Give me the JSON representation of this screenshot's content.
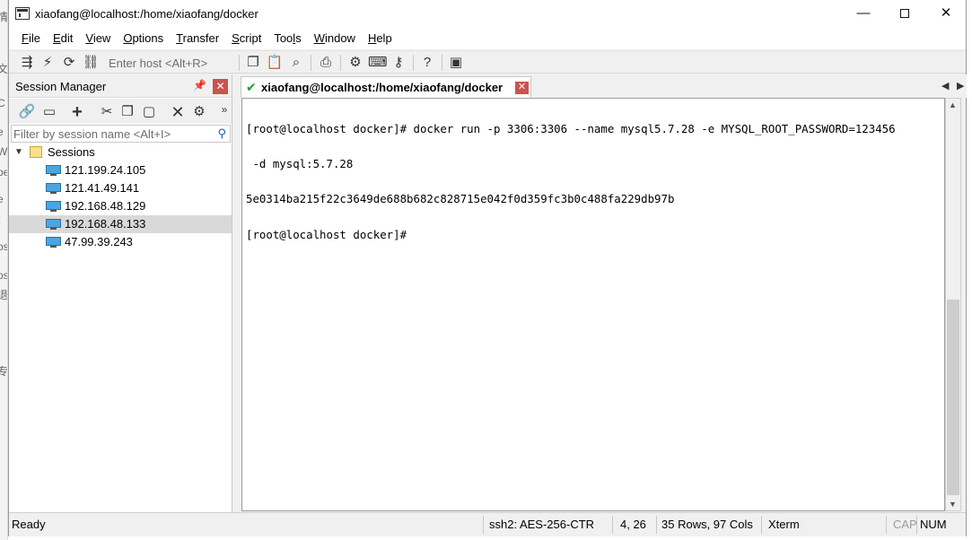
{
  "window": {
    "title": "xiaofang@localhost:/home/xiaofang/docker"
  },
  "window_controls": {
    "minimize": "—",
    "close": "✕"
  },
  "menu": [
    "File",
    "Edit",
    "View",
    "Options",
    "Transfer",
    "Script",
    "Tools",
    "Window",
    "Help"
  ],
  "menu_hotkeys": [
    "F",
    "E",
    "V",
    "O",
    "T",
    "S",
    "l",
    "W",
    "H"
  ],
  "toolbar": {
    "host_placeholder": "Enter host <Alt+R>"
  },
  "session_manager": {
    "title": "Session Manager",
    "filter_placeholder": "Filter by session name <Alt+I>",
    "folder": "Sessions",
    "sessions": [
      "121.199.24.105",
      "121.41.49.141",
      "192.168.48.129",
      "192.168.48.133",
      "47.99.39.243"
    ],
    "selected_session": "192.168.48.133"
  },
  "tab": {
    "label": "xiaofang@localhost:/home/xiaofang/docker"
  },
  "terminal": {
    "lines": [
      "[root@localhost docker]# docker run -p 3306:3306 --name mysql5.7.28 -e MYSQL_ROOT_PASSWORD=123456",
      " -d mysql:5.7.28",
      "5e0314ba215f22c3649de688b682c828715e042f0d359fc3b0c488fa229db97b",
      "[root@localhost docker]# "
    ]
  },
  "statusbar": {
    "state": "Ready",
    "encryption": "ssh2: AES-256-CTR",
    "cursor_pos": "4,  26",
    "dims": "35 Rows, 97 Cols",
    "term_type": "Xterm",
    "caps": "CAP",
    "num": "NUM"
  },
  "colors": {
    "close_red": "#c9544d",
    "selected_row": "#d9d9d9",
    "check_green": "#1ea01e",
    "monitor_blue": "#4aa6e0"
  }
}
